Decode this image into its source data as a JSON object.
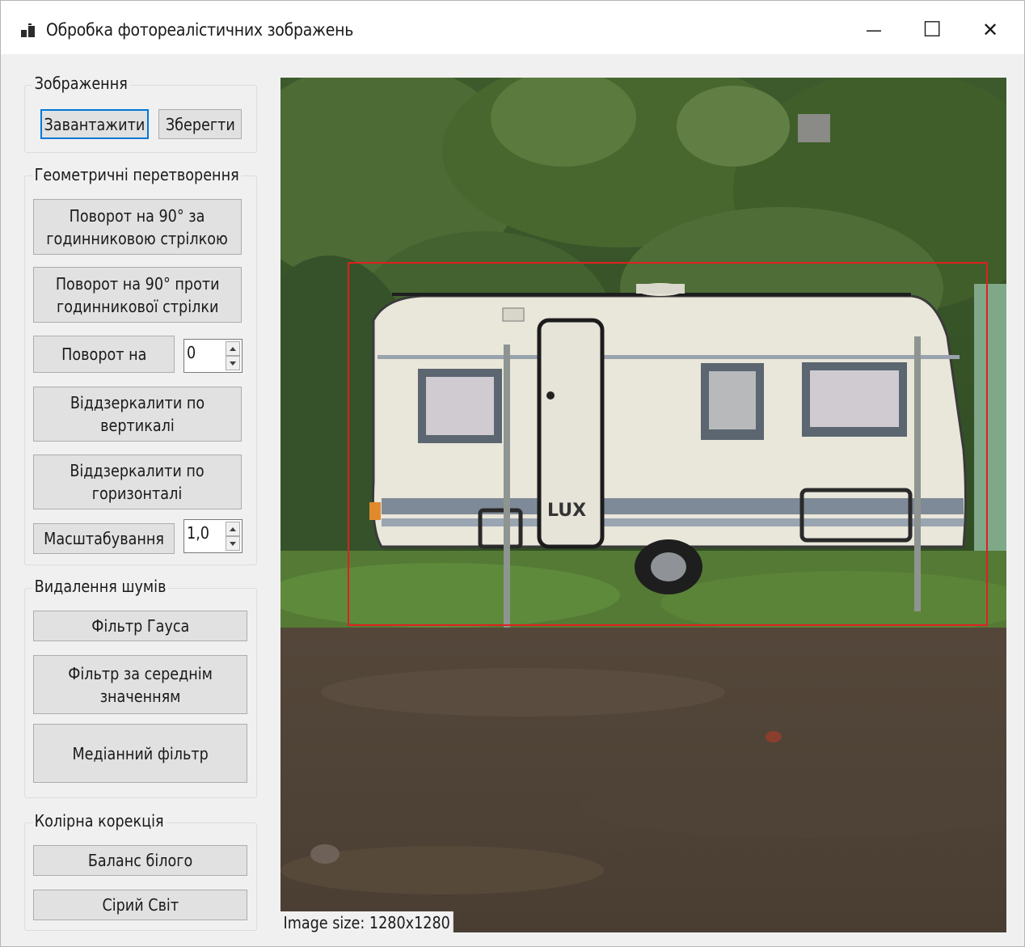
{
  "window": {
    "title": "Обробка фотореалістичних зображень",
    "icon": "app-icon",
    "controls": {
      "minimize": "—",
      "maximize": "☐",
      "close": "✕"
    }
  },
  "groups": {
    "image": {
      "label": "Зображення",
      "load_label": "Завантажити",
      "save_label": "Зберегти"
    },
    "geometry": {
      "label": "Геометричні перетворення",
      "rotate_cw_label": "Поворот на 90° за\nгодинниковою стрілкою",
      "rotate_ccw_label": "Поворот на 90° проти\nгодинникової стрілки",
      "rotate_by_label": "Поворот на",
      "rotate_value": "0",
      "mirror_vertical_label": "Віддзеркалити по вертикалі",
      "mirror_horizontal_label": "Віддзеркалити по\nгоризонталі",
      "scale_label": "Масштабування",
      "scale_value": "1,0"
    },
    "noise": {
      "label": "Видалення шумів",
      "gauss_label": "Фільтр Гауса",
      "mean_label": "Фільтр за середнім\nзначенням",
      "median_label": "Медіанний фільтр"
    },
    "color": {
      "label": "Колірна корекція",
      "white_balance_label": "Баланс білого",
      "gray_world_label": "Сірий Світ"
    }
  },
  "picture": {
    "size_label": "Image size: 1280x1280",
    "caravan_brand": "LUX",
    "selection_color": "#e02020"
  }
}
